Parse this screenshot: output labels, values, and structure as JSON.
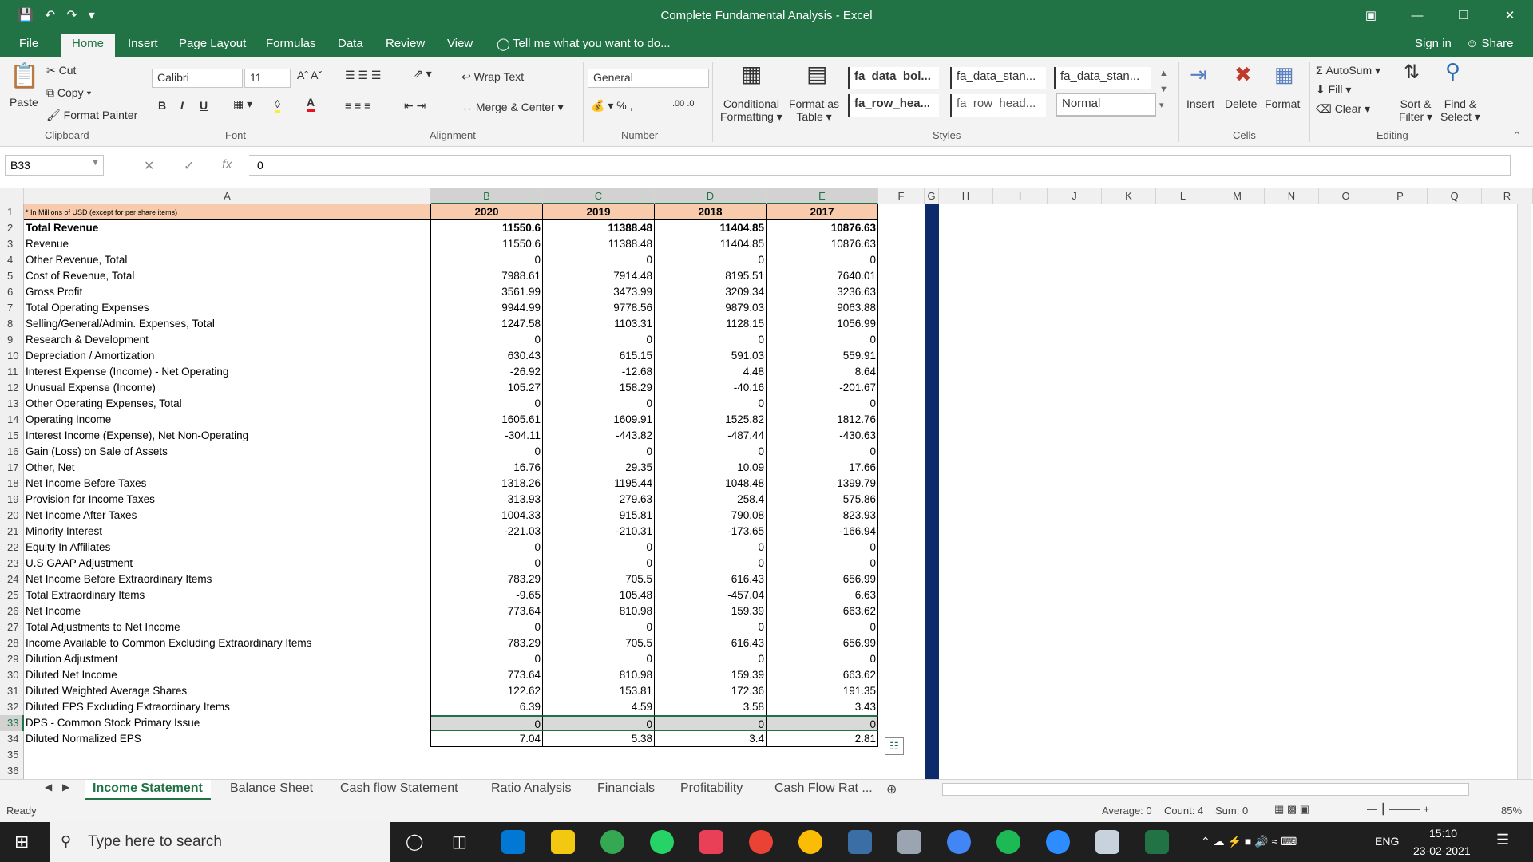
{
  "window": {
    "title": "Complete Fundamental Analysis - Excel",
    "sign_in": "Sign in",
    "share": "Share"
  },
  "menu_tabs": [
    "File",
    "Home",
    "Insert",
    "Page Layout",
    "Formulas",
    "Data",
    "Review",
    "View"
  ],
  "tell_me": "Tell me what you want to do...",
  "ribbon": {
    "clipboard": {
      "paste": "Paste",
      "cut": "Cut",
      "copy": "Copy",
      "format_painter": "Format Painter",
      "group": "Clipboard"
    },
    "font": {
      "name": "Calibri",
      "size": "11",
      "group": "Font"
    },
    "alignment": {
      "wrap_text": "Wrap Text",
      "merge_center": "Merge & Center",
      "group": "Alignment"
    },
    "number": {
      "format": "General",
      "group": "Number"
    },
    "styles": {
      "conditional": "Conditional",
      "formatting": "Formatting",
      "format_as": "Format as",
      "table": "Table",
      "items": [
        "fa_data_bol...",
        "fa_data_stan...",
        "fa_data_stan...",
        "fa_row_hea...",
        "fa_row_head...",
        "Normal"
      ],
      "group": "Styles"
    },
    "cells": {
      "insert": "Insert",
      "delete": "Delete",
      "format": "Format",
      "group": "Cells"
    },
    "editing": {
      "autosum": "AutoSum",
      "fill": "Fill",
      "clear": "Clear",
      "sort": "Sort &",
      "filter": "Filter",
      "find": "Find &",
      "select": "Select",
      "group": "Editing"
    }
  },
  "formula_bar": {
    "name_box": "B33",
    "value": "0"
  },
  "columns": [
    "A",
    "B",
    "C",
    "D",
    "E",
    "F",
    "G",
    "H",
    "I",
    "J",
    "K",
    "L",
    "M",
    "N",
    "O",
    "P",
    "Q",
    "R"
  ],
  "header_row": {
    "label": "* In Millions of USD (except for per share items)",
    "years": [
      "2020",
      "2019",
      "2018",
      "2017"
    ]
  },
  "rows": [
    {
      "n": "2",
      "label": "Total Revenue",
      "v": [
        "11550.6",
        "11388.48",
        "11404.85",
        "10876.63"
      ],
      "bold": true
    },
    {
      "n": "3",
      "label": "Revenue",
      "v": [
        "11550.6",
        "11388.48",
        "11404.85",
        "10876.63"
      ]
    },
    {
      "n": "4",
      "label": "Other Revenue, Total",
      "v": [
        "0",
        "0",
        "0",
        "0"
      ]
    },
    {
      "n": "5",
      "label": "Cost of Revenue, Total",
      "v": [
        "7988.61",
        "7914.48",
        "8195.51",
        "7640.01"
      ]
    },
    {
      "n": "6",
      "label": "Gross Profit",
      "v": [
        "3561.99",
        "3473.99",
        "3209.34",
        "3236.63"
      ]
    },
    {
      "n": "7",
      "label": "Total Operating Expenses",
      "v": [
        "9944.99",
        "9778.56",
        "9879.03",
        "9063.88"
      ]
    },
    {
      "n": "8",
      "label": "Selling/General/Admin. Expenses, Total",
      "v": [
        "1247.58",
        "1103.31",
        "1128.15",
        "1056.99"
      ]
    },
    {
      "n": "9",
      "label": "Research & Development",
      "v": [
        "0",
        "0",
        "0",
        "0"
      ]
    },
    {
      "n": "10",
      "label": "Depreciation / Amortization",
      "v": [
        "630.43",
        "615.15",
        "591.03",
        "559.91"
      ]
    },
    {
      "n": "11",
      "label": "Interest Expense (Income) - Net Operating",
      "v": [
        "-26.92",
        "-12.68",
        "4.48",
        "8.64"
      ]
    },
    {
      "n": "12",
      "label": "Unusual Expense (Income)",
      "v": [
        "105.27",
        "158.29",
        "-40.16",
        "-201.67"
      ]
    },
    {
      "n": "13",
      "label": "Other Operating Expenses, Total",
      "v": [
        "0",
        "0",
        "0",
        "0"
      ]
    },
    {
      "n": "14",
      "label": "Operating Income",
      "v": [
        "1605.61",
        "1609.91",
        "1525.82",
        "1812.76"
      ]
    },
    {
      "n": "15",
      "label": "Interest Income (Expense), Net Non-Operating",
      "v": [
        "-304.11",
        "-443.82",
        "-487.44",
        "-430.63"
      ]
    },
    {
      "n": "16",
      "label": "Gain (Loss) on Sale of Assets",
      "v": [
        "0",
        "0",
        "0",
        "0"
      ]
    },
    {
      "n": "17",
      "label": "Other, Net",
      "v": [
        "16.76",
        "29.35",
        "10.09",
        "17.66"
      ]
    },
    {
      "n": "18",
      "label": "Net Income Before Taxes",
      "v": [
        "1318.26",
        "1195.44",
        "1048.48",
        "1399.79"
      ]
    },
    {
      "n": "19",
      "label": "Provision for Income Taxes",
      "v": [
        "313.93",
        "279.63",
        "258.4",
        "575.86"
      ]
    },
    {
      "n": "20",
      "label": "Net Income After Taxes",
      "v": [
        "1004.33",
        "915.81",
        "790.08",
        "823.93"
      ]
    },
    {
      "n": "21",
      "label": "Minority Interest",
      "v": [
        "-221.03",
        "-210.31",
        "-173.65",
        "-166.94"
      ]
    },
    {
      "n": "22",
      "label": "Equity In Affiliates",
      "v": [
        "0",
        "0",
        "0",
        "0"
      ]
    },
    {
      "n": "23",
      "label": "U.S GAAP Adjustment",
      "v": [
        "0",
        "0",
        "0",
        "0"
      ]
    },
    {
      "n": "24",
      "label": "Net Income Before Extraordinary Items",
      "v": [
        "783.29",
        "705.5",
        "616.43",
        "656.99"
      ]
    },
    {
      "n": "25",
      "label": "Total Extraordinary Items",
      "v": [
        "-9.65",
        "105.48",
        "-457.04",
        "6.63"
      ]
    },
    {
      "n": "26",
      "label": "Net Income",
      "v": [
        "773.64",
        "810.98",
        "159.39",
        "663.62"
      ]
    },
    {
      "n": "27",
      "label": "Total Adjustments to Net Income",
      "v": [
        "0",
        "0",
        "0",
        "0"
      ]
    },
    {
      "n": "28",
      "label": "Income Available to Common Excluding Extraordinary Items",
      "v": [
        "783.29",
        "705.5",
        "616.43",
        "656.99"
      ]
    },
    {
      "n": "29",
      "label": "Dilution Adjustment",
      "v": [
        "0",
        "0",
        "0",
        "0"
      ]
    },
    {
      "n": "30",
      "label": "Diluted Net Income",
      "v": [
        "773.64",
        "810.98",
        "159.39",
        "663.62"
      ]
    },
    {
      "n": "31",
      "label": "Diluted Weighted Average Shares",
      "v": [
        "122.62",
        "153.81",
        "172.36",
        "191.35"
      ]
    },
    {
      "n": "32",
      "label": "Diluted EPS Excluding Extraordinary Items",
      "v": [
        "6.39",
        "4.59",
        "3.58",
        "3.43"
      ]
    },
    {
      "n": "33",
      "label": "DPS - Common Stock Primary Issue",
      "v": [
        "0",
        "0",
        "0",
        "0"
      ],
      "selected": true
    },
    {
      "n": "34",
      "label": "Diluted Normalized EPS",
      "v": [
        "7.04",
        "5.38",
        "3.4",
        "2.81"
      ]
    }
  ],
  "extra_rows": [
    "35",
    "36"
  ],
  "sheet_tabs": [
    "Income Statement",
    "Balance Sheet",
    "Cash flow Statement",
    "Ratio Analysis",
    "Financials",
    "Profitability",
    "Cash Flow Rat ..."
  ],
  "status": {
    "ready": "Ready",
    "average": "Average: 0",
    "count": "Count: 4",
    "sum": "Sum: 0",
    "zoom": "85%"
  },
  "taskbar": {
    "search": "Type here to search",
    "lang": "ENG",
    "time": "15:10",
    "date": "23-02-2021"
  }
}
